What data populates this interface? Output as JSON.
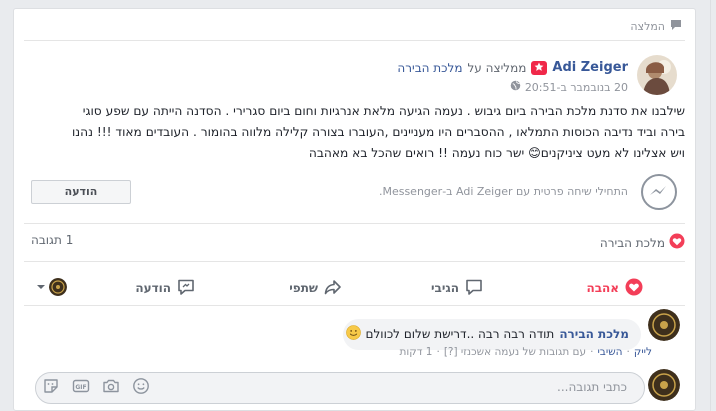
{
  "post": {
    "header_label": "המלצה",
    "author": "Adi Zeiger",
    "recommends_text": "ממליצה על",
    "page_name": "מלכת הבירה",
    "timestamp": "20 בנובמבר ב-20:51",
    "body_line1": "שילבנו את סדנת מלכת הבירה ביום גיבוש . נעמה הגיעה מלאת אנרגיות וחום ביום סגרירי . הסדנה הייתה עם שפע סוגי",
    "body_line2": "בירה וביד נדיבה הכוסות התמלאו , ההסברים היו מעניינים ,העוברו בצורה קלילה מלווה בהומור . העובדים מאוד !!! נהנו",
    "body_line3": "ויש אצלינו לא מעט ציניקנים😊 ישר כוח נעמה !! רואים שהכל בא מאהבה"
  },
  "messenger": {
    "prompt": "התחילי שיחה פרטית עם Adi Zeiger ב-Messenger.",
    "button_label": "הודעה"
  },
  "stats": {
    "reaction_name": "מלכת הבירה",
    "comment_count": "1 תגובה"
  },
  "actions": {
    "love": "אהבה",
    "comment": "הגיבי",
    "share": "שתפי",
    "message": "הודעה"
  },
  "comment": {
    "author": "מלכת הבירה",
    "text": "תודה רבה רבה ..דרישת שלום לכוולם",
    "like": "לייק",
    "reply": "השיבי",
    "edited_note": "עם תגובות של נעמה אשכנזי [?]",
    "time": "1 דקות"
  },
  "composer": {
    "placeholder": "כתבי תגובה..."
  },
  "colors": {
    "link": "#385898",
    "love": "#f33e58",
    "badge": "#f02849"
  }
}
